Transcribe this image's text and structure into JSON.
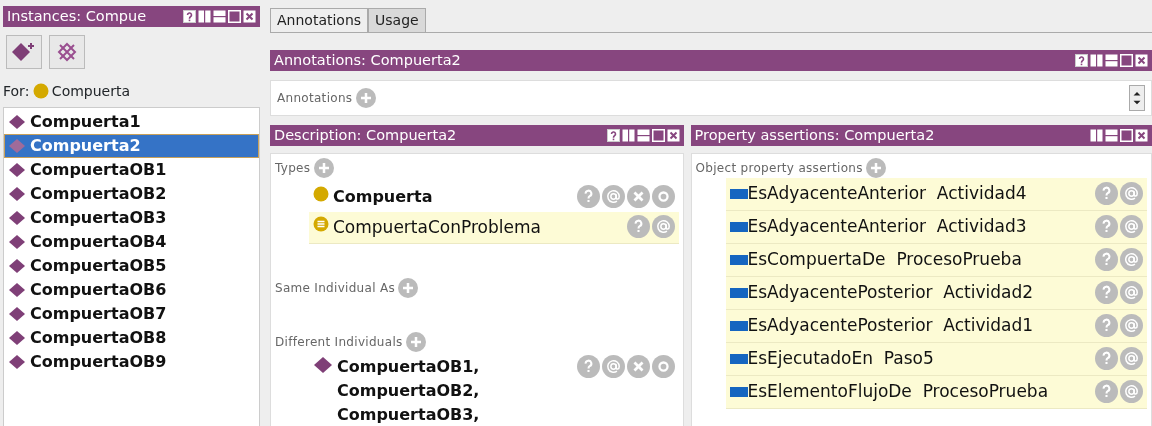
{
  "instances_panel": {
    "title": "Instances: Compue",
    "help_button": true,
    "for_label": "For:",
    "for_class": "Compuerta",
    "items": [
      {
        "label": "Compuerta1",
        "selected": false
      },
      {
        "label": "Compuerta2",
        "selected": true
      },
      {
        "label": "CompuertaOB1",
        "selected": false
      },
      {
        "label": "CompuertaOB2",
        "selected": false
      },
      {
        "label": "CompuertaOB3",
        "selected": false
      },
      {
        "label": "CompuertaOB4",
        "selected": false
      },
      {
        "label": "CompuertaOB5",
        "selected": false
      },
      {
        "label": "CompuertaOB6",
        "selected": false
      },
      {
        "label": "CompuertaOB7",
        "selected": false
      },
      {
        "label": "CompuertaOB8",
        "selected": false
      },
      {
        "label": "CompuertaOB9",
        "selected": false
      }
    ]
  },
  "tabs": [
    {
      "label": "Annotations",
      "selected": true
    },
    {
      "label": "Usage",
      "selected": false
    }
  ],
  "annotations_panel": {
    "title": "Annotations: Compuerta2",
    "help_button": true,
    "section": "Annotations"
  },
  "description_panel": {
    "title": "Description: Compuerta2",
    "help_button": true,
    "sections": [
      {
        "label": "Types",
        "items": [
          {
            "label": "Compuerta",
            "kind": "class",
            "inferred": false
          },
          {
            "label": "CompuertaConProblema",
            "kind": "defined-class",
            "inferred": true
          }
        ]
      },
      {
        "label": "Same Individual As"
      },
      {
        "label": "Different Individuals",
        "items": [
          {
            "label": "CompuertaOB1, CompuertaOB2, CompuertaOB3,",
            "kind": "individual",
            "inferred": false
          }
        ]
      }
    ]
  },
  "property_panel": {
    "title": "Property assertions: Compuerta2",
    "help_button": false,
    "section": "Object property assertions",
    "items": [
      {
        "property": "EsAdyacenteAnterior",
        "value": "Actividad4",
        "inferred": true
      },
      {
        "property": "EsAdyacenteAnterior",
        "value": "Actividad3",
        "inferred": true
      },
      {
        "property": "EsCompuertaDe",
        "value": "ProcesoPrueba",
        "inferred": true
      },
      {
        "property": "EsAdyacentePosterior",
        "value": "Actividad2",
        "inferred": true
      },
      {
        "property": "EsAdyacentePosterior",
        "value": "Actividad1",
        "inferred": true
      },
      {
        "property": "EsEjecutadoEn",
        "value": "Paso5",
        "inferred": true
      },
      {
        "property": "EsElementoFlujoDe",
        "value": "ProcesoPrueba",
        "inferred": true
      }
    ]
  }
}
